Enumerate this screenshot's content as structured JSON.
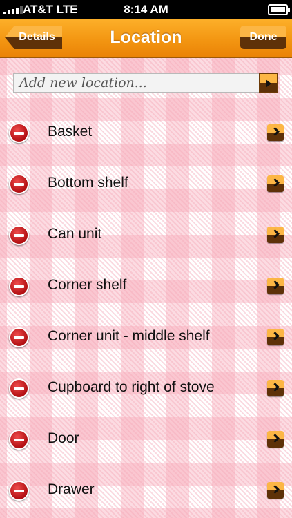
{
  "status_bar": {
    "carrier": "AT&T  LTE",
    "time": "8:14 AM"
  },
  "nav": {
    "title": "Location",
    "back_label": "Details",
    "done_label": "Done"
  },
  "add_field": {
    "placeholder": "Add new location..."
  },
  "locations": [
    "Basket",
    "Bottom shelf",
    "Can unit",
    "Corner shelf",
    "Corner unit - middle shelf",
    "Cupboard to right of stove",
    "Door",
    "Drawer"
  ],
  "colors": {
    "nav_orange": "#f39612",
    "dark_brown": "#5e3108",
    "gingham_pink": "#f7aab9",
    "delete_red": "#c8171a"
  }
}
